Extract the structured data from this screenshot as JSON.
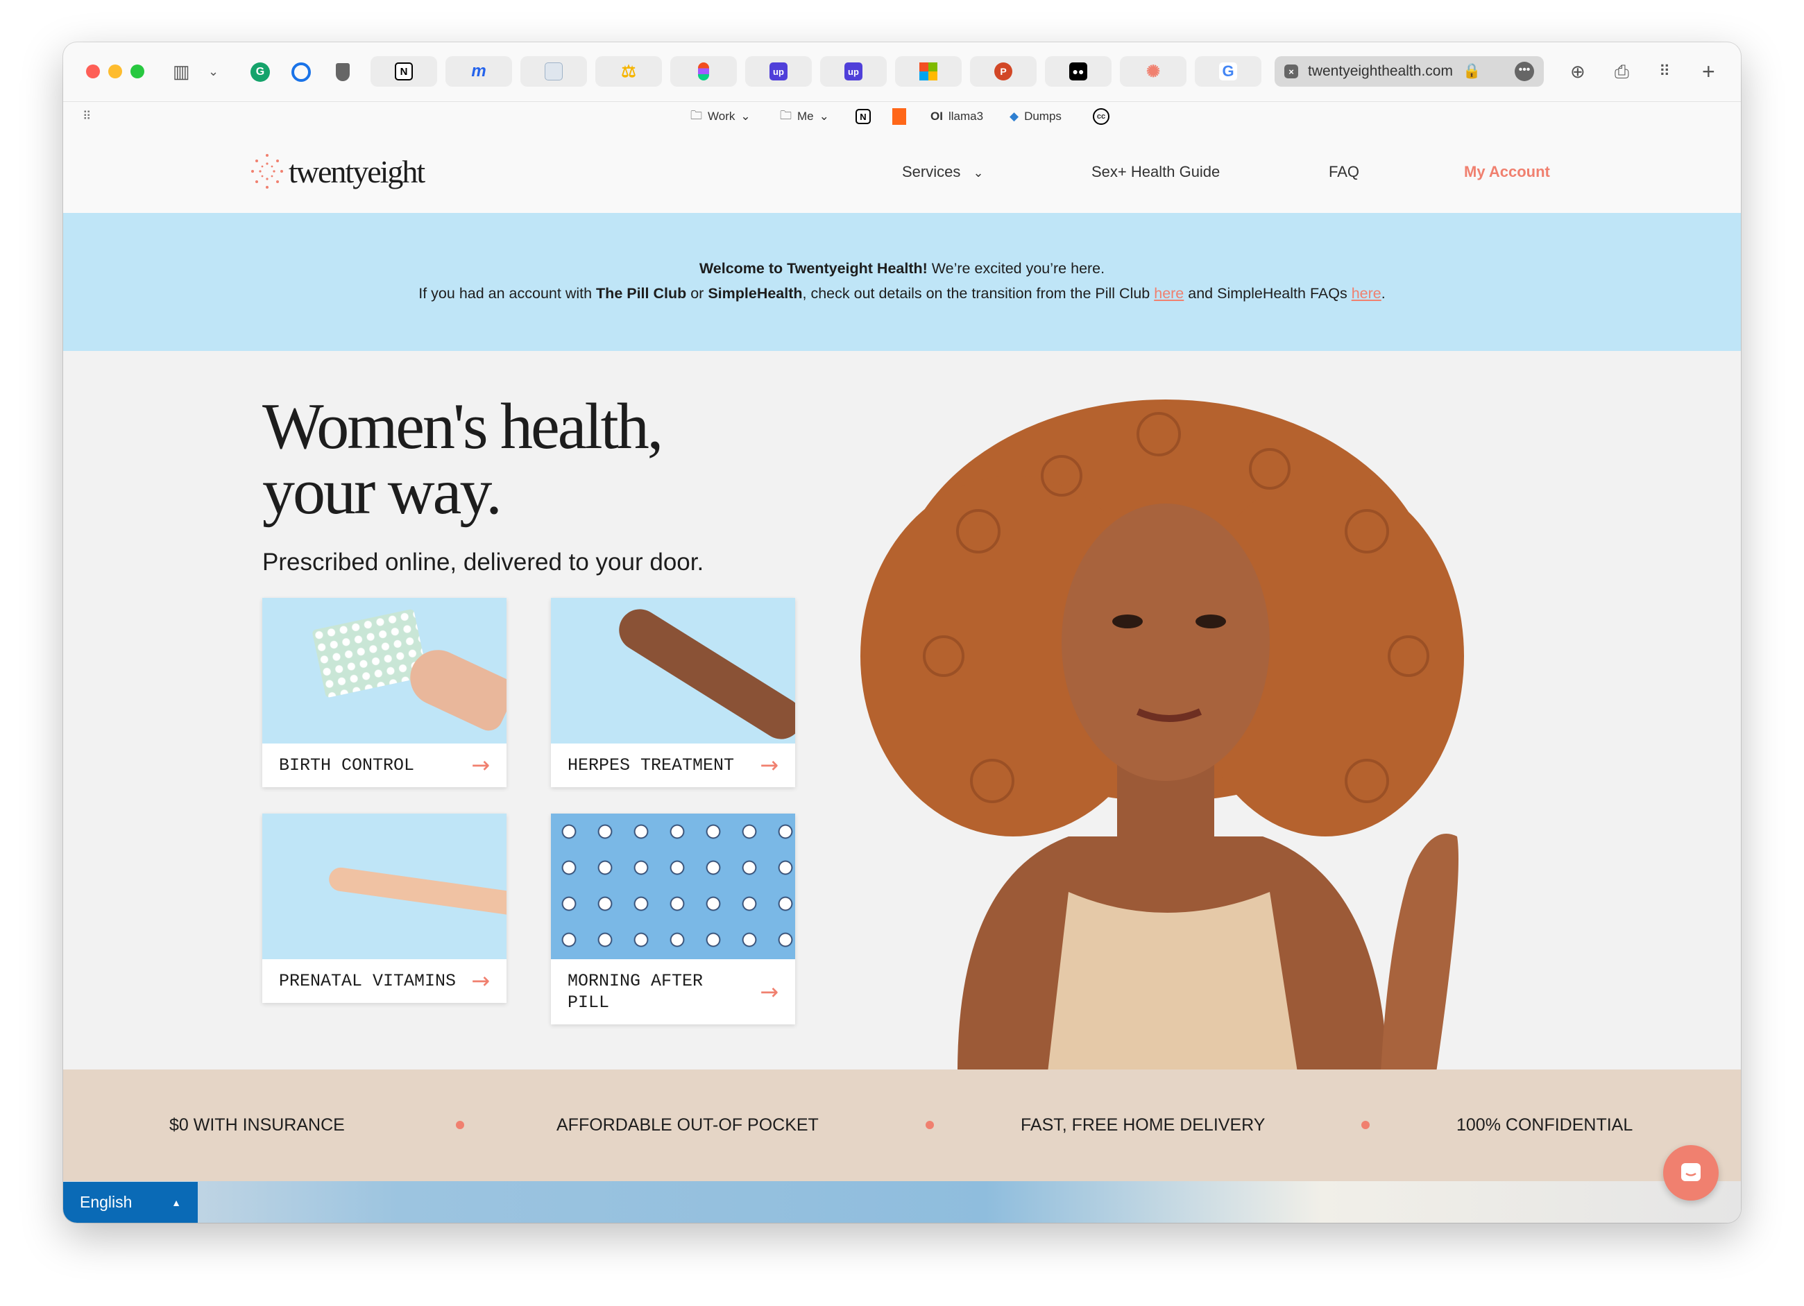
{
  "browser": {
    "tab_buttons": [
      "notion",
      "m-app",
      "document",
      "scales",
      "figma",
      "up",
      "up",
      "microsoft",
      "powerpoint",
      "medium",
      "twentyeight",
      "google"
    ],
    "address": "twentyeighthealth.com",
    "bookmarks": [
      {
        "label": "Work",
        "icon": "folder-icon",
        "menu": true
      },
      {
        "label": "Me",
        "icon": "folder-icon",
        "menu": true
      },
      {
        "label": "",
        "icon": "notion-icon"
      },
      {
        "label": "",
        "icon": "substack-icon"
      },
      {
        "label": "llama3",
        "icon": "ollama-icon"
      },
      {
        "label": "Dumps",
        "icon": "dumps-icon"
      },
      {
        "label": "",
        "icon": "cc-icon"
      }
    ]
  },
  "site": {
    "logo": "twentyeight",
    "nav": {
      "services": "Services",
      "guide": "Sex+ Health Guide",
      "faq": "FAQ",
      "account": "My Account"
    },
    "banner": {
      "line1_bold": "Welcome to Twentyeight Health!",
      "line1_rest": " We’re excited you’re here.",
      "l2_a": "If you had an account with ",
      "l2_b": "The Pill Club",
      "l2_c": " or ",
      "l2_d": "SimpleHealth",
      "l2_e": ", check out details on the transition from the Pill Club ",
      "l2_link1": "here",
      "l2_f": " and SimpleHealth FAQs ",
      "l2_link2": "here",
      "l2_g": "."
    },
    "hero": {
      "title_line1": "Women's health,",
      "title_line2": "your way.",
      "subtitle": "Prescribed online, delivered to your door.",
      "cards": [
        {
          "label": "BIRTH CONTROL"
        },
        {
          "label": "HERPES TREATMENT"
        },
        {
          "label": "PRENATAL VITAMINS"
        },
        {
          "label": "MORNING AFTER PILL"
        }
      ]
    },
    "features": [
      "$0 WITH INSURANCE",
      "AFFORDABLE OUT-OF POCKET",
      "FAST, FREE HOME DELIVERY",
      "100% CONFIDENTIAL"
    ],
    "language": "English",
    "colors": {
      "accent": "#f0806f",
      "banner": "#bfe5f7",
      "strip": "#e5d5c6",
      "lang": "#0a6ab6"
    }
  }
}
